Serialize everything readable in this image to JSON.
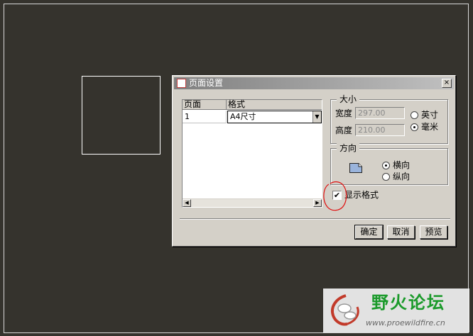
{
  "dialog": {
    "title": "页面设置",
    "close_glyph": "×"
  },
  "grid": {
    "headers": [
      "页面",
      "格式"
    ],
    "rows": [
      {
        "page": "1",
        "format": "A4尺寸"
      }
    ]
  },
  "size_group": {
    "title": "大小",
    "width_label": "宽度",
    "width_value": "297.00",
    "height_label": "高度",
    "height_value": "210.00",
    "unit_inch": "英寸",
    "unit_mm": "毫米",
    "selected_unit": "毫米"
  },
  "orientation_group": {
    "title": "方向",
    "landscape": "横向",
    "portrait": "纵向",
    "selected": "横向"
  },
  "show_format": {
    "label": "显示格式",
    "checked": true,
    "check_glyph": "✔"
  },
  "buttons": {
    "ok": "确定",
    "cancel": "取消",
    "preview": "预览"
  },
  "watermark": {
    "title": "野火论坛",
    "url": "www.proewildfire.cn"
  },
  "colors": {
    "canvas_bg": "#35332d",
    "dialog_bg": "#d4d0c8",
    "annotation": "#e01010",
    "watermark_green": "#1a9a2a"
  }
}
